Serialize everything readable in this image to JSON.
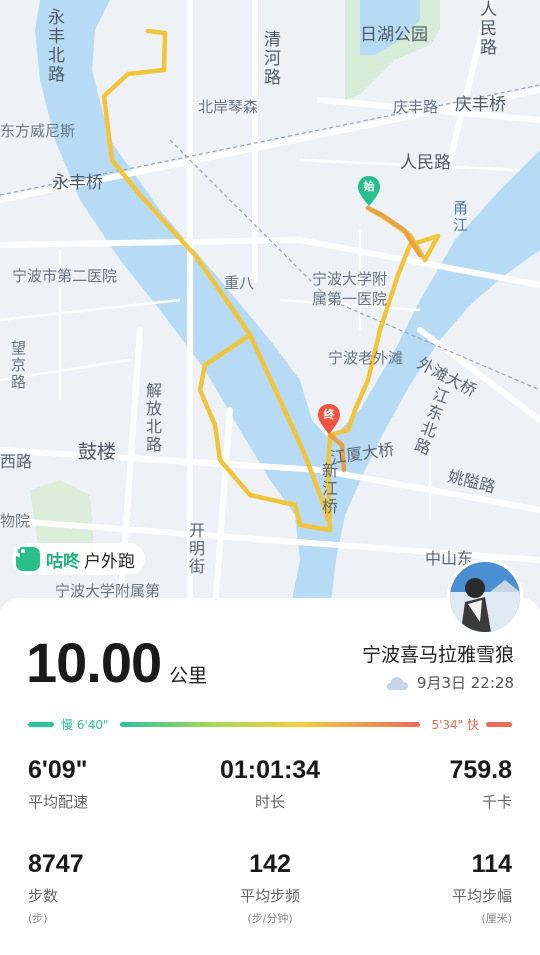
{
  "map": {
    "labels": {
      "yongjiang_n": "永丰北路",
      "qinghe": "清河路",
      "rihu": "日湖公园",
      "renmin_n": "人民路",
      "qingfeng_bridge": "庆丰桥",
      "beian": "北岸琴森",
      "qingfeng_rd": "庆丰路",
      "venice": "东方威尼斯",
      "renmin_rd": "人民路",
      "yongfeng_bridge": "永丰桥",
      "yongjiang": "甬江",
      "no2_hospital": "宁波市第二医院",
      "chongba": "重八",
      "nbu_hospital_1": "宁波大学附",
      "nbu_hospital_2": "属第一医院",
      "wangjing": "望京路",
      "laowaitan": "宁波老外滩",
      "waitan_bridge": "外滩大桥",
      "jiefang": "解放北路",
      "jiangdong": "江东北路",
      "gulou": "鼓楼",
      "xilu": "西路",
      "jiangxia": "江厦大桥",
      "yaoxi": "姚隘路",
      "xinjiang": "新江桥",
      "kaiming": "开明街",
      "wuyuan": "物院",
      "zhongshan": "中山东",
      "nbu_hospital_bottom": "宁波大学附属第"
    },
    "start_marker": "始",
    "end_marker": "终",
    "track_color": "#f2c43a"
  },
  "brand": {
    "name": "咕咚",
    "subtitle": "户外跑"
  },
  "summary": {
    "distance": "10.00",
    "distance_unit": "公里",
    "route_name": "宁波喜马拉雅雪狼",
    "weather_icon": "cloud-icon",
    "date": "9月3日 22:28"
  },
  "pace_scale": {
    "slow_label": "慢 6'40\"",
    "fast_label": "5'34\" 快",
    "slow_color": "#2cc39a",
    "fast_color": "#ea6c5b"
  },
  "stats": {
    "avg_pace": {
      "value": "6'09\"",
      "label": "平均配速"
    },
    "duration": {
      "value": "01:01:34",
      "label": "时长"
    },
    "calories": {
      "value": "759.8",
      "label": "千卡"
    },
    "steps": {
      "value": "8747",
      "label": "步数",
      "unit": "(步)"
    },
    "cadence": {
      "value": "142",
      "label": "平均步频",
      "unit": "(步/分钟)"
    },
    "stride": {
      "value": "114",
      "label": "平均步幅",
      "unit": "(厘米)"
    }
  }
}
